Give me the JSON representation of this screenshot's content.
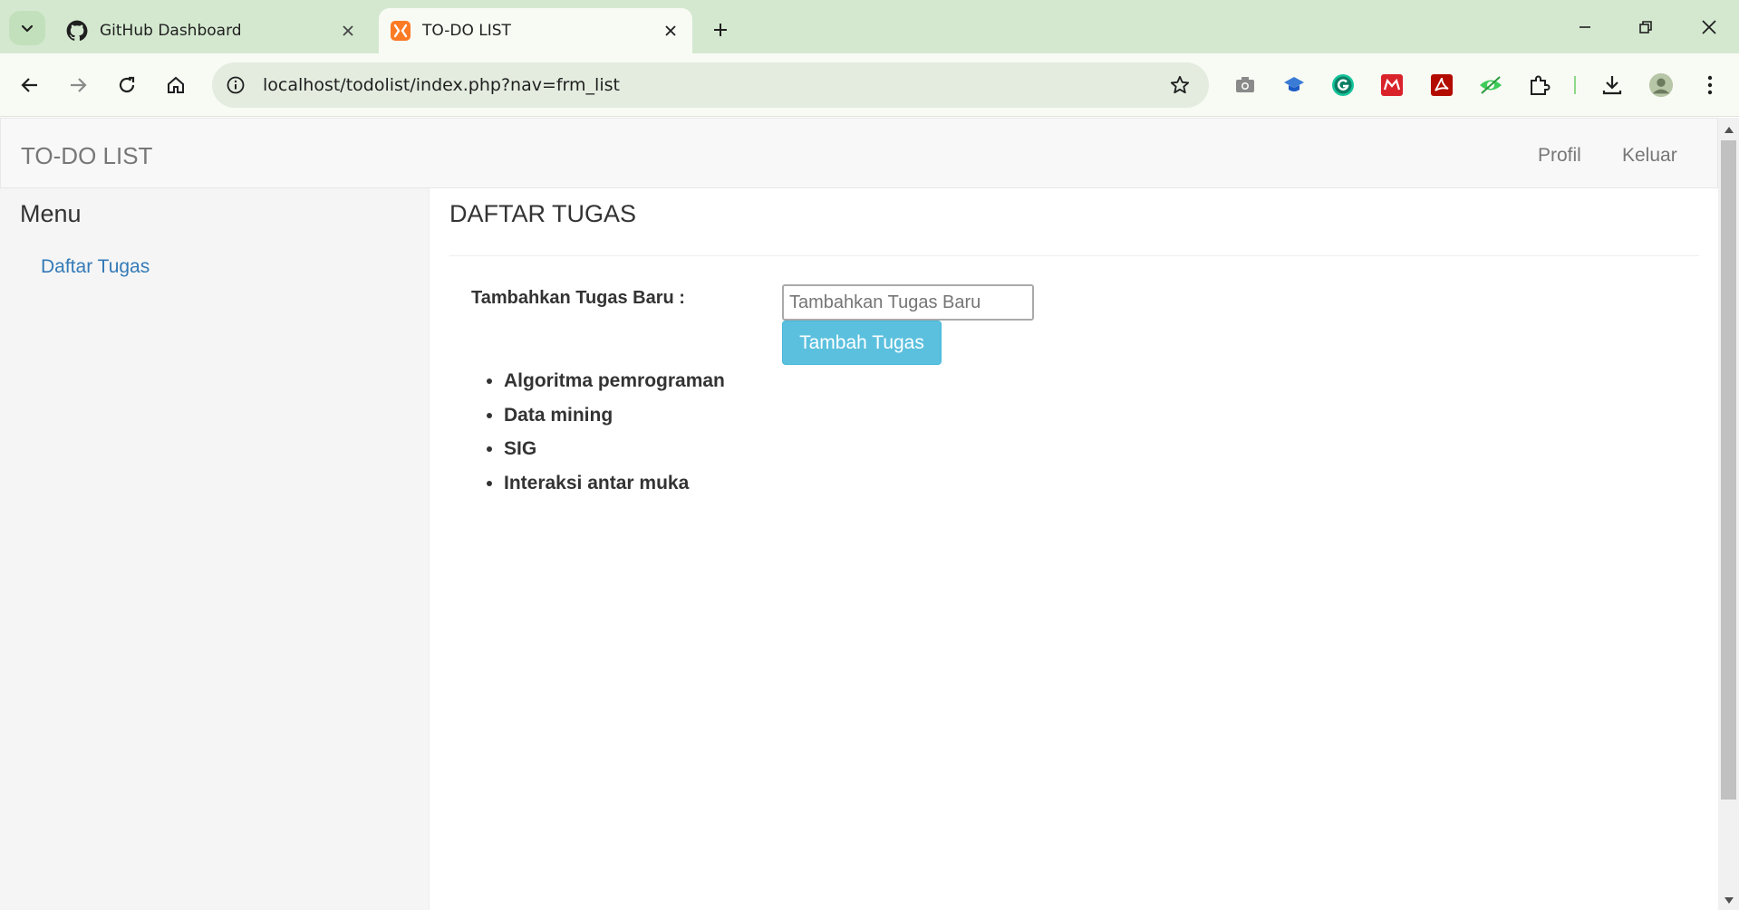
{
  "browser": {
    "tabs": [
      {
        "title": "GitHub Dashboard",
        "icon": "github-icon",
        "active": false
      },
      {
        "title": "TO-DO LIST",
        "icon": "xampp-icon",
        "active": true
      }
    ],
    "url": "localhost/todolist/index.php?nav=frm_list"
  },
  "navbar": {
    "brand": "TO-DO LIST",
    "links": [
      "Profil",
      "Keluar"
    ]
  },
  "sidebar": {
    "title": "Menu",
    "items": [
      "Daftar Tugas"
    ]
  },
  "main": {
    "title": "DAFTAR TUGAS",
    "form_label": "Tambahkan Tugas Baru :",
    "input_placeholder": "Tambahkan Tugas Baru",
    "input_value": "",
    "button_label": "Tambah Tugas",
    "tasks": [
      "Algoritma pemrograman",
      "Data mining",
      "SIG",
      "Interaksi antar muka"
    ]
  },
  "colors": {
    "tabbar": "#d4e8d0",
    "link": "#337ab7",
    "info_button": "#5bc0de"
  }
}
